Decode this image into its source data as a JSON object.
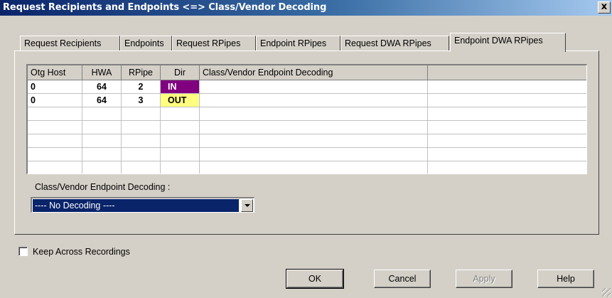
{
  "window": {
    "title": "Request Recipients and Endpoints <=> Class/Vendor Decoding",
    "close_label": "x"
  },
  "tabs": [
    {
      "label": "Request Recipients"
    },
    {
      "label": "Endpoints"
    },
    {
      "label": "Request RPipes"
    },
    {
      "label": "Endpoint RPipes"
    },
    {
      "label": "Request DWA RPipes"
    },
    {
      "label": "Endpoint DWA RPipes",
      "active": true
    }
  ],
  "grid": {
    "columns": [
      "Otg Host",
      "HWA",
      "RPipe",
      "Dir",
      "Class/Vendor Endpoint Decoding",
      ""
    ],
    "rows": [
      {
        "otg_host": "0",
        "hwa": "64",
        "rpipe": "2",
        "dir": "IN",
        "decoding": "",
        "dir_color": "#800080"
      },
      {
        "otg_host": "0",
        "hwa": "64",
        "rpipe": "3",
        "dir": "OUT",
        "decoding": "",
        "dir_color": "#ffff80"
      }
    ]
  },
  "decoding": {
    "label": "Class/Vendor Endpoint Decoding :",
    "selected": "---- No Decoding ----"
  },
  "keep_across": {
    "label": "Keep Across Recordings",
    "checked": false
  },
  "buttons": {
    "ok": "OK",
    "cancel": "Cancel",
    "apply": "Apply",
    "help": "Help"
  },
  "colors": {
    "title_bar": "#0a246a",
    "face": "#d4d0c8",
    "selection": "#0a246a"
  }
}
